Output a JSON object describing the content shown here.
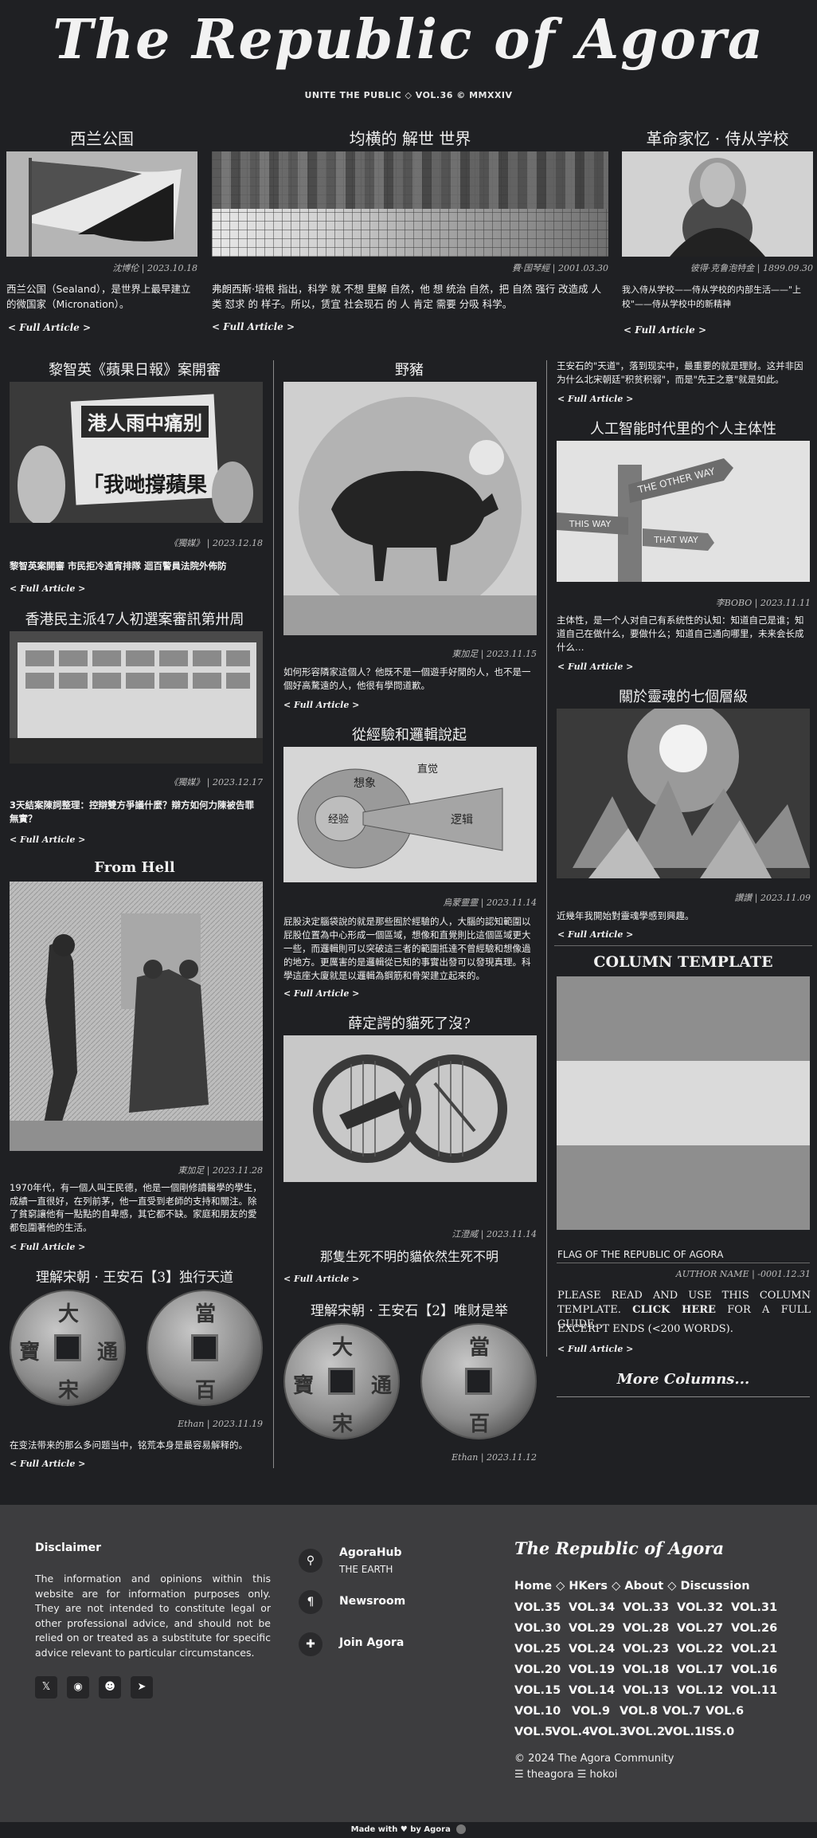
{
  "masthead": {
    "title": "The Republic of Agora",
    "tagline": "UNITE THE PUBLIC ◇ VOL.36 © MMXXIV"
  },
  "row1": [
    {
      "title": "西兰公国",
      "meta": "沈博伦 | 2023.10.18",
      "excerpt": "西兰公国（Sealand），是世界上最早建立的微国家（Micronation）。",
      "full": "< Full Article >"
    },
    {
      "title": "均横的 解世 世界",
      "meta": "費·国琴經 | 2001.03.30",
      "excerpt": "弗朗西斯·培根 指出，科学 就 不想 里解 自然，他 想 统治 自然，把 自然 强行 改造成 人类 怼求 的 样子。所以，赁宜 社会现石 的 人 肯定 需要 分吸 科学。",
      "full": "< Full Article >"
    },
    {
      "title": "革命家忆 · 侍从学校",
      "meta": "彼得·克鲁泡特金 | 1899.09.30",
      "excerpt": "我入侍从学校——侍从学校的内部生活——\"上校\"——侍从学校中的新精神",
      "full": "< Full Article >"
    }
  ],
  "col1": [
    {
      "title": "黎智英《蘋果日報》案開審",
      "meta": "《獨媒》 | 2023.12.18",
      "excerpt": "黎智英案開審 市民拒冷通宵排隊 迴百警員法院外佈防",
      "full": "< Full Article >"
    },
    {
      "title": "香港民主派47人初選案審訊第卅周",
      "meta": "《獨媒》 | 2023.12.17",
      "excerpt": "3天結案陳詞整理：控辯雙方爭議什麼？辯方如何力陳被告罪無實？",
      "full": "< Full Article >"
    },
    {
      "title": "From Hell",
      "meta": "東加足 | 2023.11.28",
      "excerpt": "1970年代，有一個人叫王民德，他是一個剛修讀醫學的學生，成績一直很好，在列前茅，他一直受到老師的支持和關注。除了貧窮讓他有一點點的自卑感，其它都不缺。家庭和朋友的愛都包圍著他的生活。",
      "full": "< Full Article >"
    },
    {
      "title": "理解宋朝 · 王安石【3】独行天道",
      "meta": "Ethan | 2023.11.19",
      "excerpt": "在变法带来的那么多问题当中，铭荒本身是最容易解释的。",
      "full": "< Full Article >"
    }
  ],
  "col2": [
    {
      "title": "野豬",
      "meta": "東加足 | 2023.11.15",
      "excerpt": "如何形容隣家這個人？他既不是一個遊手好閒的人，也不是一個好高騖遠的人，他很有學問道歉。",
      "full": "< Full Article >"
    },
    {
      "title": "從經驗和邏輯說起",
      "meta": "烏蒙靈靈 | 2023.11.14",
      "excerpt": "屁股決定腦袋說的就是那些囿於經驗的人，大腦的認知範圍以屁股位置為中心形成一個區域，想像和直覺則比這個區域更大一些，而邏輯則可以突破這三者的範圍抵達不曾經驗和想像過的地方。更厲害的是邏輯從已知的事實出發可以發現真理。科學這座大廈就是以邏輯為鋼筋和骨架建立起來的。",
      "full": "< Full Article >",
      "diagram": {
        "outer": "想象",
        "inner": "经验",
        "right": "逻辑",
        "top": "直觉"
      }
    },
    {
      "title": "薛定諤的貓死了沒?",
      "meta": "江澄威 | 2023.11.14",
      "excerpt": "那隻生死不明的貓依然生死不明",
      "full": "< Full Article >"
    },
    {
      "title": "理解宋朝 · 王安石【2】唯财是举",
      "meta": "Ethan | 2023.11.12"
    }
  ],
  "col3": [
    {
      "excerpt": "王安石的\"天道\"，落到现实中，最重要的就是理财。这并非因为什么北宋朝廷\"积贫积弱\"，而是\"先王之意\"就是如此。",
      "full": "< Full Article >"
    },
    {
      "title": "人工智能时代里的个人主体性",
      "meta": "李BOBO | 2023.11.11",
      "excerpt": "主体性，是一个人对自己有系统性的认知：知道自己是谁；知道自己在做什么，要做什么；知道自己通向哪里，未来会长成什么…",
      "full": "< Full Article >"
    },
    {
      "title": "關於靈魂的七個層級",
      "meta": "讚讚 | 2023.11.09",
      "excerpt": "近幾年我開始對靈魂學感到興趣。",
      "full": "< Full Article >"
    },
    {
      "title": "COLUMN TEMPLATE",
      "caption": "FLAG OF THE REPUBLIC OF AGORA",
      "meta": "AUTHOR NAME | -0001.12.31",
      "p1a": "PLEASE READ AND USE THIS COLUMN TEMPLATE. ",
      "p1b": "CLICK HERE",
      "p1c": " FOR A FULL GUIDE.",
      "p2": "EXCERPT ENDS (<200 WORDS).",
      "full": "< Full Article >"
    },
    {
      "more": "More Columns..."
    }
  ],
  "coins": {
    "top": "大",
    "bottom": "宋",
    "left": "寶",
    "right": "通",
    "top2": "當",
    "bottom2": "百"
  },
  "signs": {
    "a": "THE OTHER WAY",
    "b": "THIS WAY",
    "c": "THAT WAY"
  },
  "footer": {
    "disclaimer_title": "Disclaimer",
    "disclaimer": "The information and opinions within this website are for information purposes only. They are not intended to constitute legal or other professional advice, and should not be relied on or treated as a substitute for specific advice relevant to particular circumstances.",
    "hub": "AgoraHub",
    "hub_sub": "THE EARTH",
    "newsroom": "Newsroom",
    "join": "Join Agora",
    "brand": "The Republic of Agora",
    "nav": [
      "Home",
      "HKers",
      "About",
      "Discussion"
    ],
    "nav_sep": "◇",
    "vols": [
      "VOL.35",
      "VOL.34",
      "VOL.33",
      "VOL.32",
      "VOL.31",
      "VOL.30",
      "VOL.29",
      "VOL.28",
      "VOL.27",
      "VOL.26",
      "VOL.25",
      "VOL.24",
      "VOL.23",
      "VOL.22",
      "VOL.21",
      "VOL.20",
      "VOL.19",
      "VOL.18",
      "VOL.17",
      "VOL.16",
      "VOL.15",
      "VOL.14",
      "VOL.13",
      "VOL.12",
      "VOL.11",
      "VOL.10",
      "VOL.9",
      "VOL.8",
      "VOL.7",
      "VOL.6",
      "VOL.5",
      "VOL.4",
      "VOL.3",
      "VOL.2",
      "VOL.1",
      "ISS.0"
    ],
    "copyright": "© 2024 The Agora Community",
    "credits": "☰ theagora ☰ hokoi",
    "made_with": "Made with ♥ by Agora"
  }
}
